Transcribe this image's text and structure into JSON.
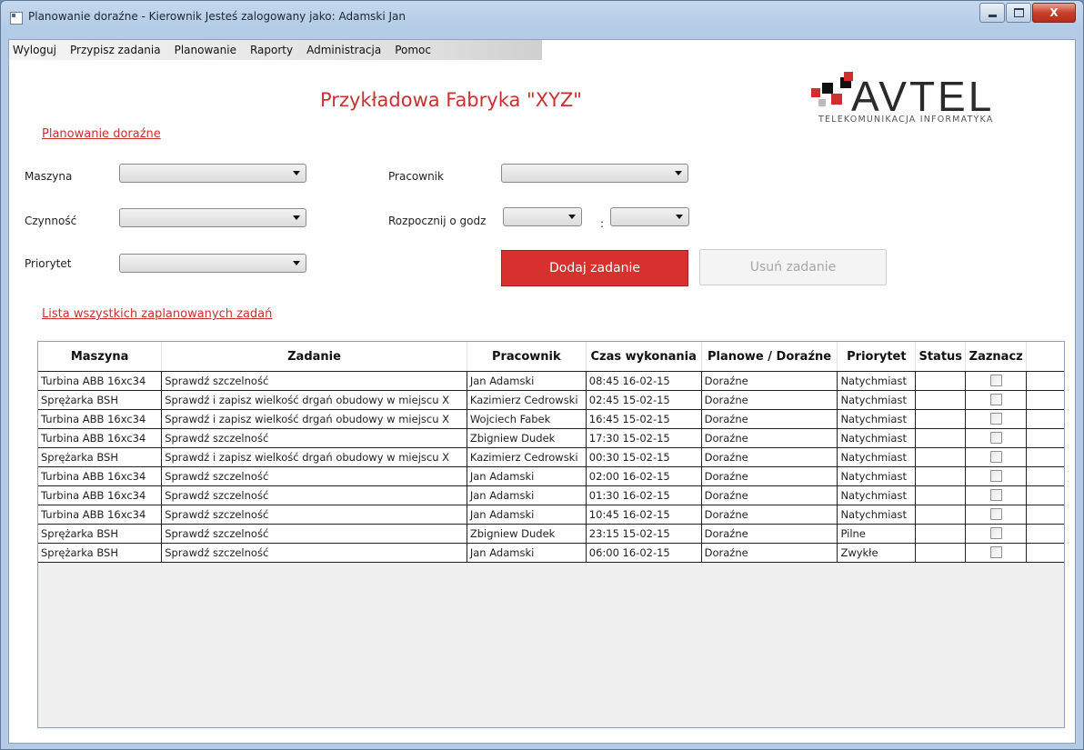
{
  "window": {
    "title": "Planowanie doraźne - Kierownik Jesteś zalogowany jako: Adamski Jan",
    "close_glyph": "X"
  },
  "menu": {
    "items": [
      "Wyloguj",
      "Przypisz zadania",
      "Planowanie",
      "Raporty",
      "Administracja",
      "Pomoc"
    ]
  },
  "header": {
    "factory_title": "Przykładowa Fabryka \"XYZ\"",
    "logo_name": "AVTEL",
    "logo_tagline": "TELEKOMUNIKACJA  INFORMATYKA"
  },
  "form": {
    "section_title": "Planowanie doraźne",
    "machine_label": "Maszyna",
    "activity_label": "Czynność",
    "priority_label": "Priorytet",
    "worker_label": "Pracownik",
    "start_label": "Rozpocznij o godz",
    "time_separator": ":",
    "add_button": "Dodaj zadanie",
    "delete_button": "Usuń zadanie"
  },
  "list": {
    "title": "Lista wszystkich zaplanowanych zadań",
    "columns": [
      "Maszyna",
      "Zadanie",
      "Pracownik",
      "Czas wykonania",
      "Planowe / Doraźne",
      "Priorytet",
      "Status",
      "Zaznacz"
    ],
    "rows": [
      {
        "machine": "Turbina ABB 16xc34",
        "task": "Sprawdź szczelność",
        "worker": "Jan Adamski",
        "time": "08:45 16-02-15",
        "type": "Doraźne",
        "priority": "Natychmiast",
        "status": ""
      },
      {
        "machine": "Sprężarka BSH",
        "task": "Sprawdź i zapisz wielkość drgań obudowy w miejscu X",
        "worker": "Kazimierz Cedrowski",
        "time": "02:45 15-02-15",
        "type": "Doraźne",
        "priority": "Natychmiast",
        "status": ""
      },
      {
        "machine": "Turbina ABB 16xc34",
        "task": "Sprawdź i zapisz wielkość drgań obudowy w miejscu X",
        "worker": "Wojciech Fabek",
        "time": "16:45 15-02-15",
        "type": "Doraźne",
        "priority": "Natychmiast",
        "status": ""
      },
      {
        "machine": "Turbina ABB 16xc34",
        "task": "Sprawdź szczelność",
        "worker": "Zbigniew Dudek",
        "time": "17:30 15-02-15",
        "type": "Doraźne",
        "priority": "Natychmiast",
        "status": ""
      },
      {
        "machine": "Sprężarka BSH",
        "task": "Sprawdź i zapisz wielkość drgań obudowy w miejscu X",
        "worker": "Kazimierz Cedrowski",
        "time": "00:30 15-02-15",
        "type": "Doraźne",
        "priority": "Natychmiast",
        "status": ""
      },
      {
        "machine": "Turbina ABB 16xc34",
        "task": "Sprawdź szczelność",
        "worker": "Jan Adamski",
        "time": "02:00 16-02-15",
        "type": "Doraźne",
        "priority": "Natychmiast",
        "status": ""
      },
      {
        "machine": "Turbina ABB 16xc34",
        "task": "Sprawdź szczelność",
        "worker": "Jan Adamski",
        "time": "01:30 16-02-15",
        "type": "Doraźne",
        "priority": "Natychmiast",
        "status": ""
      },
      {
        "machine": "Turbina ABB 16xc34",
        "task": "Sprawdź szczelność",
        "worker": "Jan Adamski",
        "time": "10:45 16-02-15",
        "type": "Doraźne",
        "priority": "Natychmiast",
        "status": ""
      },
      {
        "machine": "Sprężarka BSH",
        "task": "Sprawdź szczelność",
        "worker": "Zbigniew Dudek",
        "time": "23:15 15-02-15",
        "type": "Doraźne",
        "priority": "Pilne",
        "status": ""
      },
      {
        "machine": "Sprężarka BSH",
        "task": "Sprawdź szczelność",
        "worker": "Jan Adamski",
        "time": "06:00 16-02-15",
        "type": "Doraźne",
        "priority": "Zwykłe",
        "status": ""
      }
    ]
  },
  "colors": {
    "accent": "#d8302f",
    "link": "#c9312f",
    "window_frame": "#b3cbe5"
  },
  "icons": {
    "app": "window-app-icon",
    "combo_arrow": "chevron-down-icon",
    "logo_mark": "avtel-squares-logo"
  }
}
